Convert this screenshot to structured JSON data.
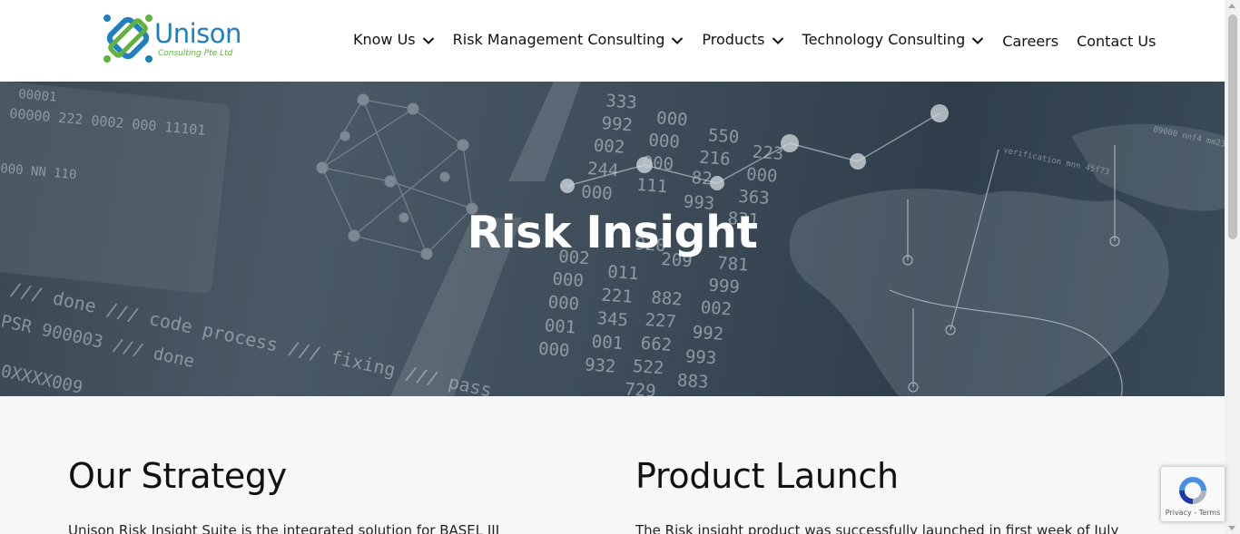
{
  "header": {
    "logo": {
      "name": "Unison",
      "subtitle": "Consulting Pte Ltd"
    },
    "nav": [
      {
        "label": "Know Us",
        "has_dropdown": true
      },
      {
        "label": "Risk Management Consulting",
        "has_dropdown": true
      },
      {
        "label": "Products",
        "has_dropdown": true
      },
      {
        "label": "Technology Consulting",
        "has_dropdown": true
      },
      {
        "label": "Careers",
        "has_dropdown": false
      },
      {
        "label": "Contact Us",
        "has_dropdown": false
      }
    ]
  },
  "hero": {
    "title": "Risk Insight",
    "background_numbers": [
      "333",
      "000",
      "550",
      "992",
      "000",
      "216",
      "223",
      "002",
      "000",
      "82",
      "000",
      "244",
      "111",
      "993",
      "363",
      "000",
      "831",
      "920",
      "209",
      "781",
      "002",
      "011",
      "999",
      "000",
      "221",
      "882",
      "000",
      "345",
      "227",
      "002",
      "001",
      "001",
      "662",
      "992",
      "000",
      "932",
      "522",
      "993",
      "729",
      "883"
    ],
    "background_text": [
      "00001",
      "00000 222 0002 000 11101",
      "000 NN 110",
      "/// done /// code process /// fixing /// pass",
      "PSR 900003 /// done",
      "0XXXX009",
      "verification mnn 45f73",
      "09000 nnf4 mm23"
    ]
  },
  "main": {
    "left": {
      "heading": "Our Strategy",
      "text": "Unison Risk Insight Suite is the integrated solution for BASEL III"
    },
    "right": {
      "heading": "Product Launch",
      "text": "The Risk insight product was successfully launched in first week of July"
    }
  },
  "recaptcha": {
    "links": "Privacy - Terms"
  },
  "colors": {
    "brand_blue": "#1f7fbf",
    "brand_green": "#5fb23c",
    "hero_overlay": "#3a4753",
    "page_background": "#f7f7f7"
  },
  "icons": [
    "unison-logo-icon",
    "chevron-down-icon",
    "recaptcha-icon"
  ]
}
